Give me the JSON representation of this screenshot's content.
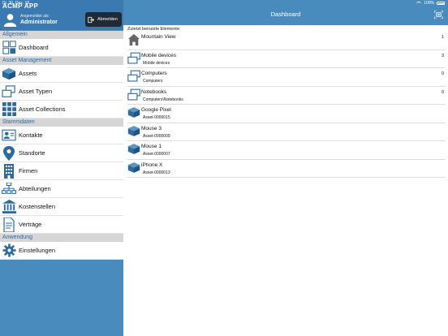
{
  "status": {
    "time": "Di. 30. Dez. 18",
    "battery": "100%"
  },
  "app_title": "ACMP APP",
  "user": {
    "label": "Angemeldet als:",
    "name": "Administrator"
  },
  "logout_label": "Abmelden",
  "nav_title": "Dashboard",
  "recent_heading": "Zuletzt benutzte Elemente:",
  "sections": {
    "allgemein": "Allgemein",
    "asset_management": "Asset Management",
    "stammdaten": "Stammdaten",
    "anwendung": "Anwendung"
  },
  "menu": {
    "dashboard": "Dashboard",
    "assets": "Assets",
    "asset_typen": "Asset Typen",
    "asset_collections": "Asset Collections",
    "kontakte": "Kontakte",
    "standorte": "Standorte",
    "firmen": "Firmen",
    "abteilungen": "Abteilungen",
    "kostenstellen": "Kostenstellen",
    "vertraege": "Verträge",
    "einstellungen": "Einstellungen"
  },
  "recent": [
    {
      "icon": "house-icon",
      "title": "Mountain View",
      "subtitle": "",
      "count": "1"
    },
    {
      "icon": "folder-icon",
      "title": "Mobile devices",
      "subtitle": "Mobile devices",
      "count": "3"
    },
    {
      "icon": "folder-icon",
      "title": "Computers",
      "subtitle": "Computers",
      "count": "0"
    },
    {
      "icon": "folder-icon",
      "title": "Notebooks",
      "subtitle": "Computers\\Notebooks",
      "count": "0"
    },
    {
      "icon": "cube-icon",
      "title": "Google Pixel",
      "subtitle": "Asset-0000015",
      "count": ""
    },
    {
      "icon": "cube-icon",
      "title": "Mouse 3",
      "subtitle": "Asset-0000009",
      "count": ""
    },
    {
      "icon": "cube-icon",
      "title": "Mouse 1",
      "subtitle": "Asset-0000007",
      "count": ""
    },
    {
      "icon": "cube-icon",
      "title": "iPhone X",
      "subtitle": "Asset-0000013",
      "count": ""
    }
  ],
  "colors": {
    "accent": "#4a8bbd",
    "header_dark": "#3a7ab0",
    "section_text": "#2c6aa0",
    "logout_bg": "#1f2a36"
  }
}
